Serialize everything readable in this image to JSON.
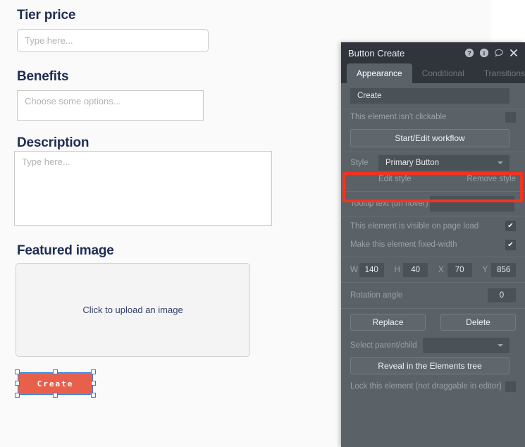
{
  "form": {
    "fields": [
      {
        "label": "Tier price",
        "placeholder": "Type here..."
      },
      {
        "label": "Benefits",
        "placeholder": "Choose some options..."
      },
      {
        "label": "Description",
        "placeholder": "Type here..."
      },
      {
        "label": "Featured image",
        "placeholder": "Click to upload an image"
      }
    ],
    "submit_button": {
      "label": "Create"
    }
  },
  "panel": {
    "title": "Button Create",
    "title_icons": [
      {
        "name": "help-icon",
        "glyph": "?"
      },
      {
        "name": "info-icon",
        "glyph": "i"
      },
      {
        "name": "comment-icon",
        "glyph": "○"
      },
      {
        "name": "close-icon",
        "glyph": "✕"
      }
    ],
    "tabs": [
      {
        "label": "Appearance",
        "active": true
      },
      {
        "label": "Conditional",
        "active": false
      },
      {
        "label": "Transitions",
        "active": false
      }
    ],
    "caption_value": "Create",
    "not_clickable_label": "This element isn't clickable",
    "not_clickable_checked": false,
    "workflow_button": "Start/Edit workflow",
    "style_label": "Style",
    "style_value": "Primary Button",
    "edit_style_link": "Edit style",
    "remove_style_link": "Remove style",
    "tooltip_label": "Tooltip text (on hover)",
    "tooltip_value": "",
    "visible_on_load_label": "This element is visible on page load",
    "visible_on_load_checked": true,
    "fixed_width_label": "Make this element fixed-width",
    "fixed_width_checked": true,
    "geometry": [
      {
        "label": "W",
        "value": "140"
      },
      {
        "label": "H",
        "value": "40"
      },
      {
        "label": "X",
        "value": "70"
      },
      {
        "label": "Y",
        "value": "856"
      }
    ],
    "rotation_label": "Rotation angle",
    "rotation_value": "0",
    "replace_button": "Replace",
    "delete_button": "Delete",
    "select_parent_label": "Select parent/child",
    "select_parent_value": "",
    "reveal_button": "Reveal in the Elements tree",
    "lock_label": "Lock this element (not draggable in editor)",
    "lock_checked": false
  },
  "colors": {
    "accent_red": "#e8604c",
    "highlight_red": "#f4341f",
    "selection_blue": "#2f7ae0",
    "panel_bg": "#5a6167",
    "panel_titlebar": "#2f353a",
    "label_navy": "#1f2d53"
  }
}
